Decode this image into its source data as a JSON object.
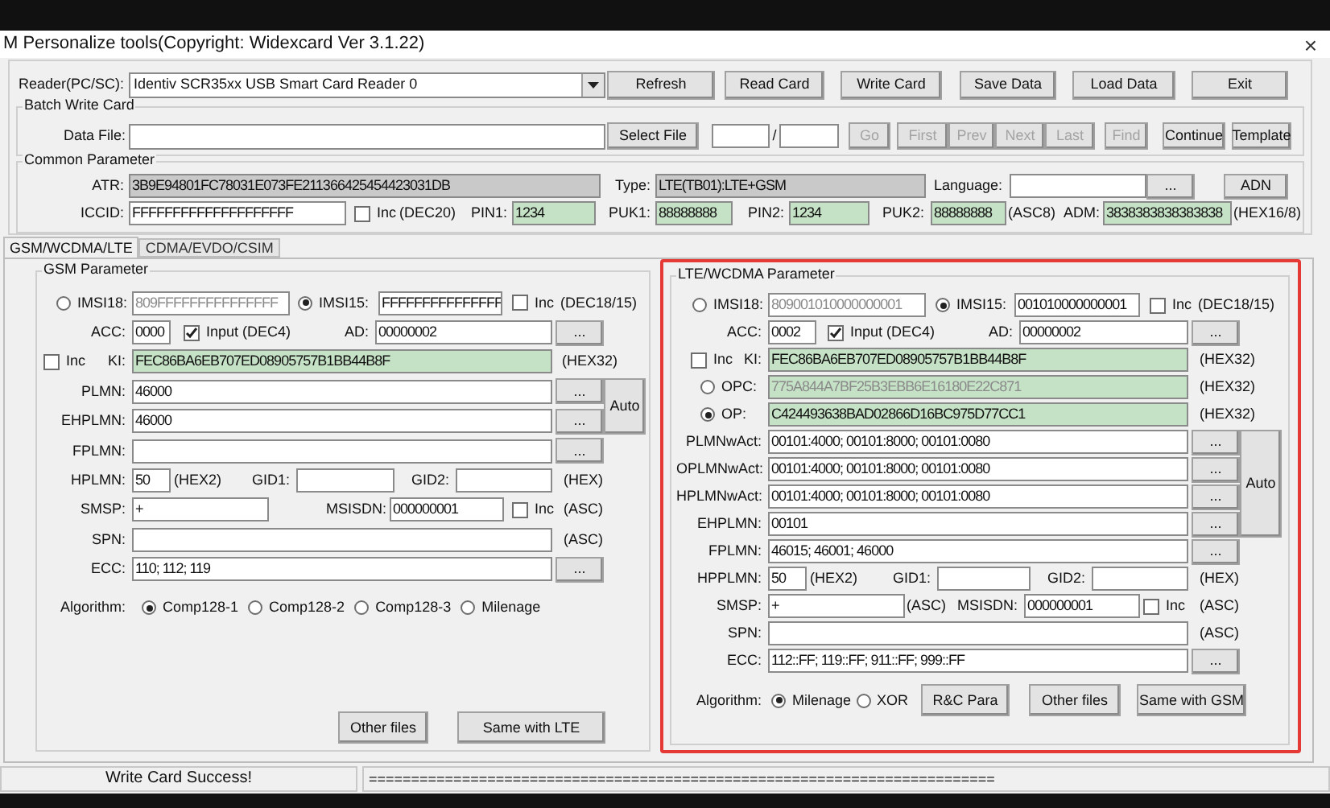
{
  "window": {
    "title": "M Personalize tools(Copyright: Widexcard Ver 3.1.22)",
    "close": "×"
  },
  "reader": {
    "label": "Reader(PC/SC):",
    "value": "Identiv SCR35xx USB Smart Card Reader 0"
  },
  "toolbar_buttons": [
    "Refresh",
    "Read Card",
    "Write Card",
    "Save Data",
    "Load Data",
    "Exit"
  ],
  "batch": {
    "title": "Batch Write Card",
    "data_file_label": "Data File:",
    "select_file": "Select File",
    "separator": "/",
    "buttons": [
      {
        "label": "Go",
        "disabled": true
      },
      {
        "label": "First",
        "disabled": true
      },
      {
        "label": "Prev",
        "disabled": true
      },
      {
        "label": "Next",
        "disabled": true
      },
      {
        "label": "Last",
        "disabled": true
      },
      {
        "label": "Find",
        "disabled": true
      },
      {
        "label": "Continue",
        "disabled": false
      },
      {
        "label": "Template",
        "disabled": false
      }
    ]
  },
  "common": {
    "title": "Common Parameter",
    "atr_label": "ATR:",
    "atr": "3B9E94801FC78031E073FE211366425454423031DB",
    "type_label": "Type:",
    "type": "LTE(TB01):LTE+GSM",
    "language_label": "Language:",
    "language_button": "...",
    "adn_button": "ADN",
    "iccid_label": "ICCID:",
    "iccid": "FFFFFFFFFFFFFFFFFFFF",
    "iccid_inc": {
      "label": "Inc",
      "checked": false
    },
    "iccid_note": "(DEC20)",
    "pin1_label": "PIN1:",
    "pin1": "1234",
    "puk1_label": "PUK1:",
    "puk1": "88888888",
    "pin2_label": "PIN2:",
    "pin2": "1234",
    "puk2_label": "PUK2:",
    "puk2": "88888888",
    "puk2_note": "(ASC8)",
    "adm_label": "ADM:",
    "adm": "3838383838383838",
    "adm_note": "(HEX16/8)"
  },
  "tabs": [
    {
      "label": "GSM/WCDMA/LTE",
      "selected": true
    },
    {
      "label": "CDMA/EVDO/CSIM",
      "selected": false
    }
  ],
  "gsm": {
    "title": "GSM Parameter",
    "imsi18": {
      "label": "IMSI18:",
      "value": "809FFFFFFFFFFFFFFF",
      "selected": false
    },
    "imsi15": {
      "label": "IMSI15:",
      "value": "FFFFFFFFFFFFFFF",
      "selected": true
    },
    "imsi_inc": {
      "label": "Inc",
      "checked": false
    },
    "imsi_note": "(DEC18/15)",
    "acc_label": "ACC:",
    "acc": "0000",
    "input": {
      "label": "Input (DEC4)",
      "checked": true
    },
    "ad_label": "AD:",
    "ad": "00000002",
    "ad_button": "...",
    "ki_inc": {
      "label": "Inc",
      "checked": false
    },
    "ki_label": "KI:",
    "ki": "FEC86BA6EB707ED08905757B1BB44B8F",
    "ki_note": "(HEX32)",
    "plmn_label": "PLMN:",
    "plmn": "46000",
    "plmn_button": "...",
    "ehplmn_label": "EHPLMN:",
    "ehplmn": "46000",
    "ehplmn_button": "...",
    "auto_button": "Auto",
    "fplmn_label": "FPLMN:",
    "fplmn_button": "...",
    "hplmn_label": "HPLMN:",
    "hplmn": "50",
    "hplmn_note": "(HEX2)",
    "gid1_label": "GID1:",
    "gid2_label": "GID2:",
    "gid_note": "(HEX)",
    "smsp_label": "SMSP:",
    "smsp": "+",
    "msisdn_label": "MSISDN:",
    "msisdn": "000000001",
    "msisdn_inc": {
      "label": "Inc",
      "checked": false
    },
    "msisdn_note": "(ASC)",
    "spn_label": "SPN:",
    "spn_note": "(ASC)",
    "ecc_label": "ECC:",
    "ecc": "110; 112; 119",
    "ecc_button": "...",
    "algorithm_label": "Algorithm:",
    "algorithms": [
      {
        "label": "Comp128-1",
        "selected": true
      },
      {
        "label": "Comp128-2",
        "selected": false
      },
      {
        "label": "Comp128-3",
        "selected": false
      },
      {
        "label": "Milenage",
        "selected": false
      }
    ],
    "buttons": [
      "Other files",
      "Same with LTE"
    ]
  },
  "lte": {
    "title": "LTE/WCDMA Parameter",
    "imsi18": {
      "label": "IMSI18:",
      "value": "809001010000000001",
      "selected": false
    },
    "imsi15": {
      "label": "IMSI15:",
      "value": "001010000000001",
      "selected": true
    },
    "imsi_inc": {
      "label": "Inc",
      "checked": false
    },
    "imsi_note": "(DEC18/15)",
    "acc_label": "ACC:",
    "acc": "0002",
    "input": {
      "label": "Input (DEC4)",
      "checked": true
    },
    "ad_label": "AD:",
    "ad": "00000002",
    "ad_button": "...",
    "ki_inc": {
      "label": "Inc",
      "checked": false
    },
    "ki_label": "KI:",
    "ki": "FEC86BA6EB707ED08905757B1BB44B8F",
    "ki_note": "(HEX32)",
    "opc": {
      "label": "OPC:",
      "value": "775A844A7BF25B3EBB6E16180E22C871",
      "selected": false
    },
    "opc_note": "(HEX32)",
    "op": {
      "label": "OP:",
      "value": "C424493638BAD02866D16BC975D77CC1",
      "selected": true
    },
    "op_note": "(HEX32)",
    "plmn_rows": [
      {
        "label": "PLMNwAct:",
        "value": "00101:4000; 00101:8000; 00101:0080",
        "button": "..."
      },
      {
        "label": "OPLMNwAct:",
        "value": "00101:4000; 00101:8000; 00101:0080",
        "button": "..."
      },
      {
        "label": "HPLMNwAct:",
        "value": "00101:4000; 00101:8000; 00101:0080",
        "button": "..."
      },
      {
        "label": "EHPLMN:",
        "value": "00101",
        "button": "..."
      }
    ],
    "auto_button": "Auto",
    "fplmn_label": "FPLMN:",
    "fplmn": "46015; 46001; 46000",
    "fplmn_button": "...",
    "hpplmn_label": "HPPLMN:",
    "hpplmn": "50",
    "hpplmn_note": "(HEX2)",
    "gid1_label": "GID1:",
    "gid2_label": "GID2:",
    "gid_note": "(HEX)",
    "smsp_label": "SMSP:",
    "smsp": "+",
    "smsp_note": "(ASC)",
    "msisdn_label": "MSISDN:",
    "msisdn": "000000001",
    "msisdn_inc": {
      "label": "Inc",
      "checked": false
    },
    "msisdn_note": "(ASC)",
    "spn_label": "SPN:",
    "spn_note": "(ASC)",
    "ecc_label": "ECC:",
    "ecc": "112::FF; 119::FF; 911::FF; 999::FF",
    "ecc_button": "...",
    "algorithm_label": "Algorithm:",
    "algorithms": [
      {
        "label": "Milenage",
        "selected": true
      },
      {
        "label": "XOR",
        "selected": false
      }
    ],
    "buttons": [
      "R&C Para",
      "Other files",
      "Same with GSM"
    ]
  },
  "status_bar": {
    "message": "Write Card Success!",
    "panel_text": "=========================================================================="
  }
}
